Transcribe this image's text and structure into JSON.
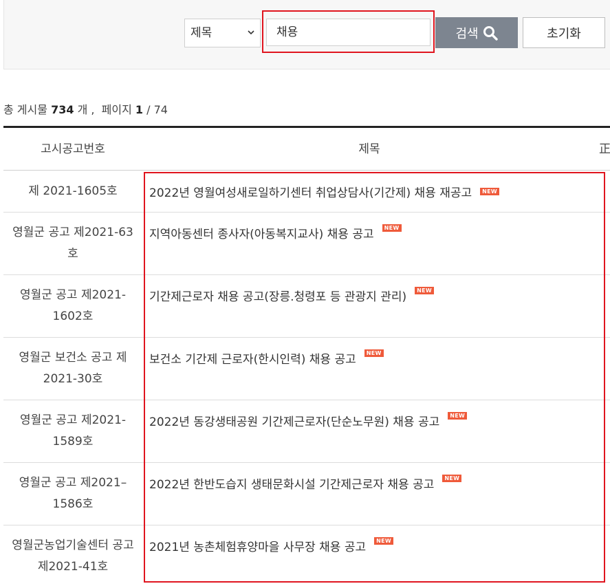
{
  "search": {
    "field_select": "제목",
    "query_value": "채용",
    "search_label": "검색",
    "reset_label": "초기화"
  },
  "summary": {
    "prefix": "총 게시물",
    "total": "734",
    "unit": "개 ,",
    "page_label": "페이지",
    "current_page": "1",
    "total_pages": "/ 74"
  },
  "table": {
    "headers": {
      "no": "고시공고번호",
      "title": "제목",
      "extra": "正"
    },
    "badge": "NEW",
    "rows": [
      {
        "no": "제 2021-1605호",
        "title": "2022년 영월여성새로일하기센터 취업상담사(기간제) 채용 재공고"
      },
      {
        "no": "영월군 공고 제2021-63호",
        "title": "지역아동센터 종사자(아동복지교사) 채용 공고"
      },
      {
        "no": "영월군 공고 제2021-1602호",
        "title": "기간제근로자 채용 공고(장릉.청령포 등 관광지 관리)"
      },
      {
        "no": "영월군 보건소 공고 제2021-30호",
        "title": "보건소 기간제 근로자(한시인력) 채용 공고"
      },
      {
        "no": "영월군 공고 제2021-1589호",
        "title": "2022년 동강생태공원 기간제근로자(단순노무원) 채용 공고"
      },
      {
        "no": "영월군 공고 제2021–1586호",
        "title": "2022년 한반도습지 생태문화시설 기간제근로자 채용 공고"
      },
      {
        "no": "영월군농업기술센터 공고 제2021-41호",
        "title": "2021년 농촌체험휴양마을 사무장 채용 공고"
      }
    ]
  },
  "colors": {
    "highlight": "#e0141e",
    "search_button": "#7d8590",
    "badge": "#ef5a3a"
  }
}
